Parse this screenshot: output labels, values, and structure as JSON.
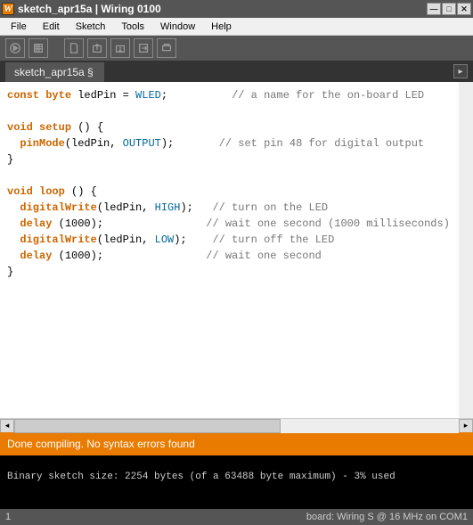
{
  "title": {
    "icon_letter": "W",
    "text": "sketch_apr15a | Wiring 0100"
  },
  "menu": {
    "items": [
      "File",
      "Edit",
      "Sketch",
      "Tools",
      "Window",
      "Help"
    ]
  },
  "tabs": {
    "active": "sketch_apr15a §"
  },
  "code": {
    "lines": [
      {
        "t": "l1",
        "storage": "const",
        "type": "byte",
        "ident": " ledPin = ",
        "const": "WLED",
        "post": ";",
        "pad": "          ",
        "comment": "// a name for the on-board LED"
      },
      {
        "t": "blank"
      },
      {
        "t": "func",
        "ret": "void",
        "name": "setup",
        "post": " () {"
      },
      {
        "t": "call",
        "indent": "  ",
        "fn": "pinMode",
        "args_open": "(ledPin, ",
        "const": "OUTPUT",
        "args_close": ");",
        "pad": "       ",
        "comment": "// set pin 48 for digital output"
      },
      {
        "t": "plain",
        "text": "}"
      },
      {
        "t": "blank"
      },
      {
        "t": "func",
        "ret": "void",
        "name": "loop",
        "post": " () {"
      },
      {
        "t": "call",
        "indent": "  ",
        "fn": "digitalWrite",
        "args_open": "(ledPin, ",
        "const": "HIGH",
        "args_close": ");",
        "pad": "   ",
        "comment": "// turn on the LED"
      },
      {
        "t": "call",
        "indent": "  ",
        "fn": "delay",
        "args_open": " (1000);",
        "const": "",
        "args_close": "",
        "pad": "                ",
        "comment": "// wait one second (1000 milliseconds)"
      },
      {
        "t": "call",
        "indent": "  ",
        "fn": "digitalWrite",
        "args_open": "(ledPin, ",
        "const": "LOW",
        "args_close": ");",
        "pad": "    ",
        "comment": "// turn off the LED"
      },
      {
        "t": "call",
        "indent": "  ",
        "fn": "delay",
        "args_open": " (1000);",
        "const": "",
        "args_close": "",
        "pad": "                ",
        "comment": "// wait one second"
      },
      {
        "t": "plain",
        "text": "}"
      }
    ]
  },
  "status": {
    "compile": "Done compiling. No syntax errors found"
  },
  "console": {
    "text": "Binary sketch size: 2254 bytes (of a 63488 byte maximum) - 3% used"
  },
  "footer": {
    "left": "1",
    "right": "board: Wiring S @ 16 MHz on COM1"
  }
}
